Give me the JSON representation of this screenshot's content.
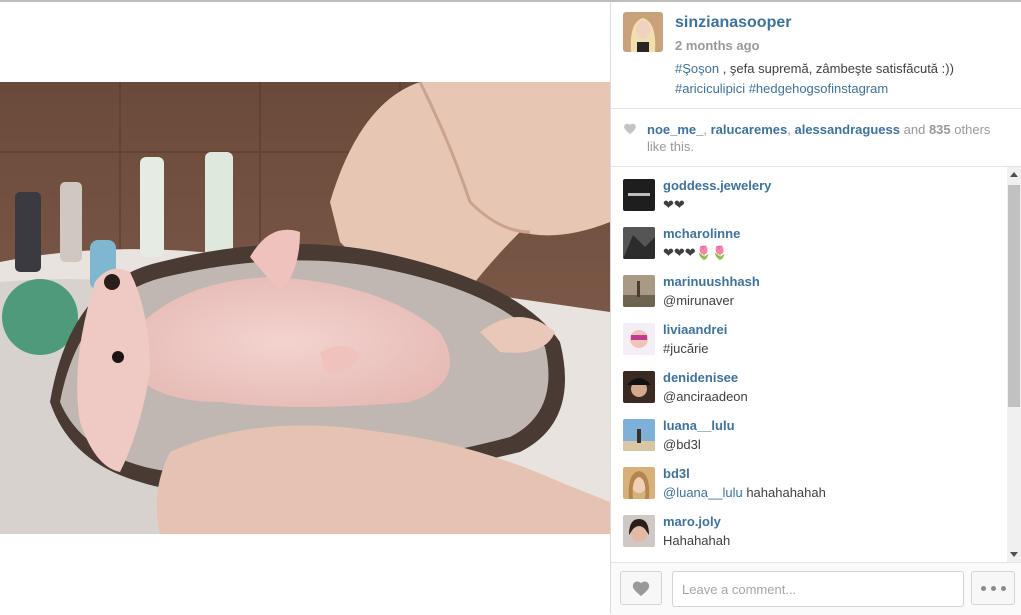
{
  "post": {
    "owner": "sinzianasooper",
    "time": "2 months ago",
    "caption": {
      "tag1": "#Şoşon",
      "text": " , şefa supremă, zâmbeşte satisfăcută :))",
      "tag2": "#ariciculipici",
      "tag3": "#hedgehogsofinstagram"
    },
    "photo_icon": "hedgehog-photo"
  },
  "likes": {
    "user1": "noe_me_",
    "user2": "ralucaremes",
    "user3": "alessandraguess",
    "and_label": "and",
    "count": "835",
    "suffix": "others like this."
  },
  "comments": [
    {
      "user": "goddess.jewelery",
      "text": "❤❤"
    },
    {
      "user": "mcharolinne",
      "text": "❤❤❤🌷🌷"
    },
    {
      "user": "marinuushhash",
      "text": "@mirunaver"
    },
    {
      "user": "liviaandrei",
      "text": "#jucărie"
    },
    {
      "user": "denidenisee",
      "text": "@anciraadeon"
    },
    {
      "user": "luana__lulu",
      "text": "@bd3l"
    },
    {
      "user": "bd3l",
      "mention": "@luana__lulu",
      "text": " hahahahahah"
    },
    {
      "user": "maro.joly",
      "text": "Hahahahah"
    }
  ],
  "footer": {
    "placeholder": "Leave a comment..."
  },
  "colors": {
    "link": "#3f729b",
    "muted": "#999999",
    "text": "#3f3f3f"
  }
}
